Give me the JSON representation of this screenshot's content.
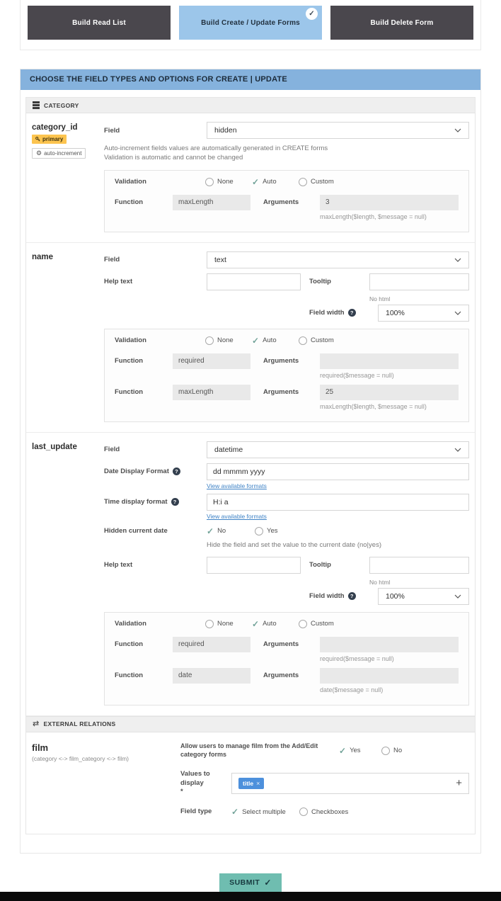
{
  "icons": {
    "check": "✓",
    "swap": "⇄",
    "gear": "⚙",
    "plus": "+",
    "close": "×",
    "question": "?",
    "submit_check": "✓"
  },
  "tabs": {
    "read": "Build Read List",
    "create": "Build Create / Update Forms",
    "delete": "Build Delete Form"
  },
  "header": {
    "title": "CHOOSE THE FIELD TYPES AND OPTIONS FOR CREATE | UPDATE"
  },
  "category": {
    "section_title": "CATEGORY",
    "category_id": {
      "name": "category_id",
      "primary_badge": "primary",
      "auto_increment_badge": "auto-increment",
      "field_label": "Field",
      "field_value": "hidden",
      "note_line1": "Auto-increment fields values are automatically generated in CREATE forms",
      "note_line2": "Validation is automatic and cannot be changed",
      "validation": {
        "label": "Validation",
        "none": "None",
        "auto": "Auto",
        "custom": "Custom"
      },
      "fn1": {
        "function_label": "Function",
        "function": "maxLength",
        "arguments_label": "Arguments",
        "arguments": "3",
        "hint": "maxLength($length, $message = null)"
      }
    },
    "name_field": {
      "name": "name",
      "field_label": "Field",
      "field_value": "text",
      "help_label": "Help text",
      "help_value": "",
      "tooltip_label": "Tooltip",
      "tooltip_value": "",
      "no_html": "No html",
      "field_width_label": "Field width",
      "field_width_value": "100%",
      "validation": {
        "label": "Validation",
        "none": "None",
        "auto": "Auto",
        "custom": "Custom"
      },
      "fn1": {
        "function_label": "Function",
        "function": "required",
        "arguments_label": "Arguments",
        "arguments": "",
        "hint": "required($message = null)"
      },
      "fn2": {
        "function_label": "Function",
        "function": "maxLength",
        "arguments_label": "Arguments",
        "arguments": "25",
        "hint": "maxLength($length, $message = null)"
      }
    },
    "last_update": {
      "name": "last_update",
      "field_label": "Field",
      "field_value": "datetime",
      "date_format_label": "Date Display Format",
      "date_format_value": "dd mmmm yyyy",
      "date_formats_link": "View available formats",
      "time_format_label": "Time display format",
      "time_format_value": "H:i a",
      "time_formats_link": "View available formats",
      "hidden_current_label": "Hidden current date",
      "hidden_no": "No",
      "hidden_yes": "Yes",
      "hidden_note": "Hide the field and set the value to the current date (no|yes)",
      "help_label": "Help text",
      "help_value": "",
      "tooltip_label": "Tooltip",
      "tooltip_value": "",
      "no_html": "No html",
      "field_width_label": "Field width",
      "field_width_value": "100%",
      "validation": {
        "label": "Validation",
        "none": "None",
        "auto": "Auto",
        "custom": "Custom"
      },
      "fn1": {
        "function_label": "Function",
        "function": "required",
        "arguments_label": "Arguments",
        "arguments": "",
        "hint": "required($message = null)"
      },
      "fn2": {
        "function_label": "Function",
        "function": "date",
        "arguments_label": "Arguments",
        "arguments": "",
        "hint": "date($message = null)"
      }
    }
  },
  "external": {
    "section_title": "EXTERNAL RELATIONS",
    "film": {
      "name": "film",
      "relation_path": "(category <-> film_category <-> film)",
      "manage_label": "Allow users to manage film from the Add/Edit category forms",
      "yes": "Yes",
      "no": "No",
      "values_label": "Values to display",
      "required_star": "*",
      "chip": "title",
      "field_type_label": "Field type",
      "select_multiple": "Select multiple",
      "checkboxes": "Checkboxes"
    }
  },
  "submit": {
    "label": "SUBMIT"
  }
}
